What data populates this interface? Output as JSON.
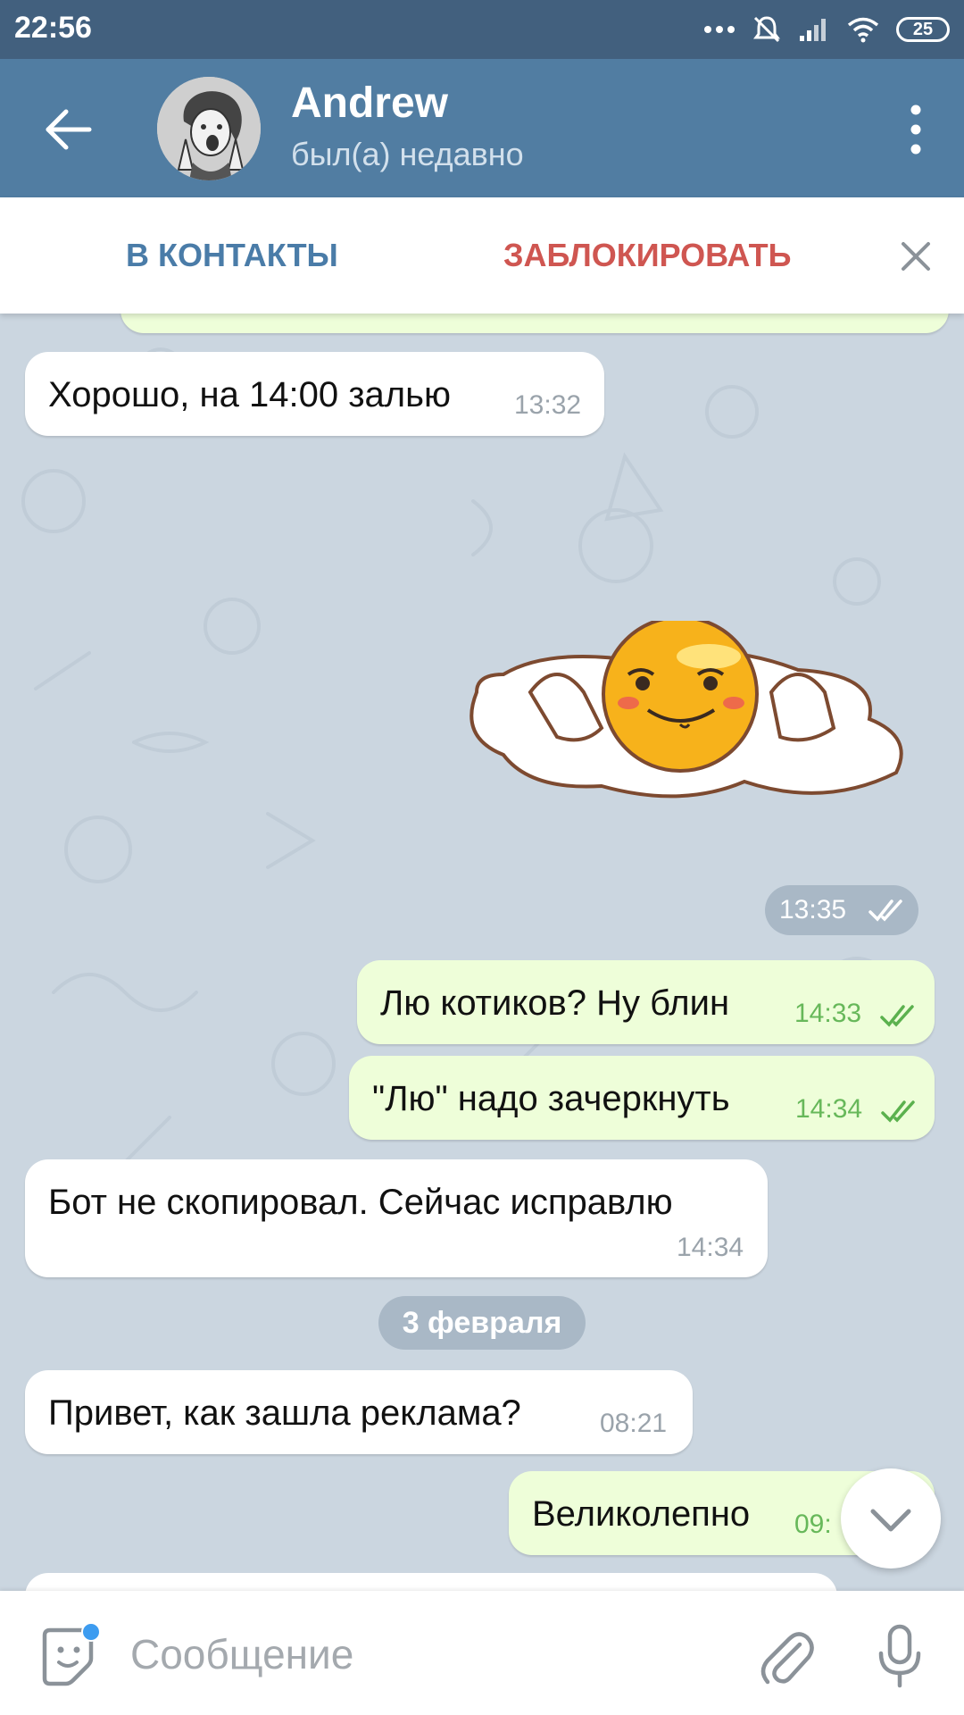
{
  "status_bar": {
    "time": "22:56",
    "battery": "25"
  },
  "header": {
    "title": "Andrew",
    "subtitle": "был(а) недавно"
  },
  "action_bar": {
    "add_contact": "В КОНТАКТЫ",
    "block": "ЗАБЛОКИРОВАТЬ"
  },
  "messages": [
    {
      "direction": "in",
      "text": "Хорошо, на 14:00 залью",
      "time": "13:32"
    },
    {
      "direction": "out",
      "sticker": "fried-egg-smiley",
      "time": "13:35",
      "read": true
    },
    {
      "direction": "out",
      "text": "Лю котиков? Ну блин",
      "time": "14:33",
      "read": true
    },
    {
      "direction": "out",
      "text": "\"Лю\" надо зачеркнуть",
      "time": "14:34",
      "read": true
    },
    {
      "direction": "in",
      "text": "Бот не скопировал. Сейчас исправлю",
      "time": "14:34"
    },
    {
      "direction": "in",
      "text": "Привет, как зашла реклама?",
      "time": "08:21"
    },
    {
      "direction": "out",
      "text": "Великолепно",
      "time": "09:",
      "read": true
    }
  ],
  "date_separator": "3 февраля",
  "composer": {
    "placeholder": "Сообщение"
  },
  "colors": {
    "header": "#517da2",
    "status_bar": "#42607e",
    "out_bubble": "#eefed9",
    "add_contact": "#4a7ca8",
    "block": "#cf5651"
  },
  "icons": [
    "back-arrow-icon",
    "more-vert-icon",
    "close-icon",
    "double-check-icon",
    "chevron-down-icon",
    "sticker-icon",
    "paperclip-icon",
    "microphone-icon"
  ]
}
